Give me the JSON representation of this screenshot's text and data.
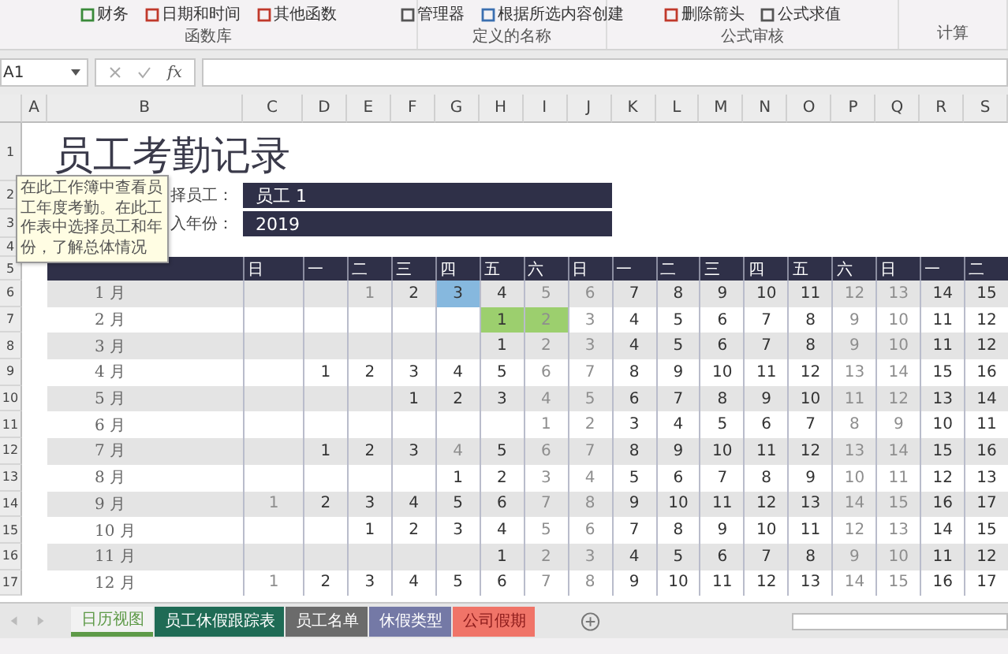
{
  "ribbon": {
    "groups": [
      {
        "label": "函数库",
        "items": [
          "财务",
          "日期和时间",
          "其他函数"
        ]
      },
      {
        "label": "定义的名称",
        "items": [
          "管理器",
          "根据所选内容创建"
        ]
      },
      {
        "label": "公式审核",
        "items": [
          "删除箭头",
          "公式求值"
        ]
      },
      {
        "label": "计算"
      }
    ]
  },
  "formula_bar": {
    "name_box": "A1",
    "function_label": "fx"
  },
  "columns": [
    "A",
    "B",
    "C",
    "D",
    "E",
    "F",
    "G",
    "H",
    "I",
    "J",
    "K",
    "L",
    "M",
    "N",
    "O",
    "P",
    "Q",
    "R",
    "S"
  ],
  "row_numbers": [
    "1",
    "2",
    "3",
    "4",
    "5",
    "6",
    "7",
    "8",
    "9",
    "10",
    "11",
    "12",
    "13",
    "14",
    "15",
    "16",
    "17"
  ],
  "sheet": {
    "title": "员工考勤记录",
    "fields": [
      {
        "label": "择员工：",
        "value": "员工 1"
      },
      {
        "label": "入年份：",
        "value": "2019"
      }
    ],
    "tooltip": "在此工作簿中查看员工年度考勤。在此工作表中选择员工和年份，了解总体情况",
    "weekdays": [
      "日",
      "一",
      "二",
      "三",
      "四",
      "五",
      "六",
      "日",
      "一",
      "二",
      "三",
      "四",
      "五",
      "六",
      "日",
      "一",
      "二"
    ],
    "months": [
      {
        "label": "1 月",
        "days": [
          {
            "kind": "blank"
          },
          {
            "kind": "blank"
          },
          {
            "kind": "date",
            "day": "1",
            "muted": true
          },
          {
            "kind": "date",
            "day": "2",
            "muted": false
          },
          {
            "kind": "date",
            "day": "3",
            "muted": false,
            "color": "#86b8de"
          },
          {
            "kind": "date",
            "day": "4",
            "muted": false
          },
          {
            "kind": "date",
            "day": "5",
            "muted": true
          },
          {
            "kind": "date",
            "day": "6",
            "muted": true
          },
          {
            "kind": "date",
            "day": "7",
            "muted": false
          },
          {
            "kind": "date",
            "day": "8",
            "muted": false
          },
          {
            "kind": "date",
            "day": "9",
            "muted": false
          },
          {
            "kind": "date",
            "day": "10",
            "muted": false
          },
          {
            "kind": "date",
            "day": "11",
            "muted": false
          },
          {
            "kind": "date",
            "day": "12",
            "muted": true
          },
          {
            "kind": "date",
            "day": "13",
            "muted": true
          },
          {
            "kind": "date",
            "day": "14",
            "muted": false
          },
          {
            "kind": "date",
            "day": "15",
            "muted": false
          }
        ]
      },
      {
        "label": "2 月",
        "days": [
          {
            "kind": "blank"
          },
          {
            "kind": "blank"
          },
          {
            "kind": "blank"
          },
          {
            "kind": "blank"
          },
          {
            "kind": "blank"
          },
          {
            "kind": "date",
            "day": "1",
            "muted": false,
            "color": "#9ccf6e"
          },
          {
            "kind": "date",
            "day": "2",
            "muted": true,
            "color": "#9ccf6e"
          },
          {
            "kind": "date",
            "day": "3",
            "muted": true
          },
          {
            "kind": "date",
            "day": "4",
            "muted": false
          },
          {
            "kind": "date",
            "day": "5",
            "muted": false
          },
          {
            "kind": "date",
            "day": "6",
            "muted": false
          },
          {
            "kind": "date",
            "day": "7",
            "muted": false
          },
          {
            "kind": "date",
            "day": "8",
            "muted": false
          },
          {
            "kind": "date",
            "day": "9",
            "muted": true
          },
          {
            "kind": "date",
            "day": "10",
            "muted": true
          },
          {
            "kind": "date",
            "day": "11",
            "muted": false
          },
          {
            "kind": "date",
            "day": "12",
            "muted": false
          }
        ]
      },
      {
        "label": "3 月",
        "days": [
          {
            "kind": "blank"
          },
          {
            "kind": "blank"
          },
          {
            "kind": "blank"
          },
          {
            "kind": "blank"
          },
          {
            "kind": "blank"
          },
          {
            "kind": "date",
            "day": "1",
            "muted": false
          },
          {
            "kind": "date",
            "day": "2",
            "muted": true
          },
          {
            "kind": "date",
            "day": "3",
            "muted": true
          },
          {
            "kind": "date",
            "day": "4",
            "muted": false
          },
          {
            "kind": "date",
            "day": "5",
            "muted": false
          },
          {
            "kind": "date",
            "day": "6",
            "muted": false
          },
          {
            "kind": "date",
            "day": "7",
            "muted": false
          },
          {
            "kind": "date",
            "day": "8",
            "muted": false
          },
          {
            "kind": "date",
            "day": "9",
            "muted": true
          },
          {
            "kind": "date",
            "day": "10",
            "muted": true
          },
          {
            "kind": "date",
            "day": "11",
            "muted": false
          },
          {
            "kind": "date",
            "day": "12",
            "muted": false
          }
        ]
      },
      {
        "label": "4 月",
        "days": [
          {
            "kind": "blank"
          },
          {
            "kind": "date",
            "day": "1",
            "muted": false
          },
          {
            "kind": "date",
            "day": "2",
            "muted": false
          },
          {
            "kind": "date",
            "day": "3",
            "muted": false
          },
          {
            "kind": "date",
            "day": "4",
            "muted": false
          },
          {
            "kind": "date",
            "day": "5",
            "muted": false
          },
          {
            "kind": "date",
            "day": "6",
            "muted": true
          },
          {
            "kind": "date",
            "day": "7",
            "muted": true
          },
          {
            "kind": "date",
            "day": "8",
            "muted": false
          },
          {
            "kind": "date",
            "day": "9",
            "muted": false
          },
          {
            "kind": "date",
            "day": "10",
            "muted": false
          },
          {
            "kind": "date",
            "day": "11",
            "muted": false
          },
          {
            "kind": "date",
            "day": "12",
            "muted": false
          },
          {
            "kind": "date",
            "day": "13",
            "muted": true
          },
          {
            "kind": "date",
            "day": "14",
            "muted": true
          },
          {
            "kind": "date",
            "day": "15",
            "muted": false
          },
          {
            "kind": "date",
            "day": "16",
            "muted": false
          }
        ]
      },
      {
        "label": "5 月",
        "days": [
          {
            "kind": "blank"
          },
          {
            "kind": "blank"
          },
          {
            "kind": "blank"
          },
          {
            "kind": "date",
            "day": "1",
            "muted": false
          },
          {
            "kind": "date",
            "day": "2",
            "muted": false
          },
          {
            "kind": "date",
            "day": "3",
            "muted": false
          },
          {
            "kind": "date",
            "day": "4",
            "muted": true
          },
          {
            "kind": "date",
            "day": "5",
            "muted": true
          },
          {
            "kind": "date",
            "day": "6",
            "muted": false
          },
          {
            "kind": "date",
            "day": "7",
            "muted": false
          },
          {
            "kind": "date",
            "day": "8",
            "muted": false
          },
          {
            "kind": "date",
            "day": "9",
            "muted": false
          },
          {
            "kind": "date",
            "day": "10",
            "muted": false
          },
          {
            "kind": "date",
            "day": "11",
            "muted": true
          },
          {
            "kind": "date",
            "day": "12",
            "muted": true
          },
          {
            "kind": "date",
            "day": "13",
            "muted": false
          },
          {
            "kind": "date",
            "day": "14",
            "muted": false
          }
        ]
      },
      {
        "label": "6 月",
        "days": [
          {
            "kind": "blank"
          },
          {
            "kind": "blank"
          },
          {
            "kind": "blank"
          },
          {
            "kind": "blank"
          },
          {
            "kind": "blank"
          },
          {
            "kind": "blank"
          },
          {
            "kind": "date",
            "day": "1",
            "muted": true
          },
          {
            "kind": "date",
            "day": "2",
            "muted": true
          },
          {
            "kind": "date",
            "day": "3",
            "muted": false
          },
          {
            "kind": "date",
            "day": "4",
            "muted": false
          },
          {
            "kind": "date",
            "day": "5",
            "muted": false
          },
          {
            "kind": "date",
            "day": "6",
            "muted": false
          },
          {
            "kind": "date",
            "day": "7",
            "muted": false
          },
          {
            "kind": "date",
            "day": "8",
            "muted": true
          },
          {
            "kind": "date",
            "day": "9",
            "muted": true
          },
          {
            "kind": "date",
            "day": "10",
            "muted": false
          },
          {
            "kind": "date",
            "day": "11",
            "muted": false
          }
        ]
      },
      {
        "label": "7 月",
        "days": [
          {
            "kind": "blank"
          },
          {
            "kind": "date",
            "day": "1",
            "muted": false
          },
          {
            "kind": "date",
            "day": "2",
            "muted": false
          },
          {
            "kind": "date",
            "day": "3",
            "muted": false
          },
          {
            "kind": "date",
            "day": "4",
            "muted": true
          },
          {
            "kind": "date",
            "day": "5",
            "muted": false
          },
          {
            "kind": "date",
            "day": "6",
            "muted": true
          },
          {
            "kind": "date",
            "day": "7",
            "muted": true
          },
          {
            "kind": "date",
            "day": "8",
            "muted": false
          },
          {
            "kind": "date",
            "day": "9",
            "muted": false
          },
          {
            "kind": "date",
            "day": "10",
            "muted": false
          },
          {
            "kind": "date",
            "day": "11",
            "muted": false
          },
          {
            "kind": "date",
            "day": "12",
            "muted": false
          },
          {
            "kind": "date",
            "day": "13",
            "muted": true
          },
          {
            "kind": "date",
            "day": "14",
            "muted": true
          },
          {
            "kind": "date",
            "day": "15",
            "muted": false
          },
          {
            "kind": "date",
            "day": "16",
            "muted": false
          }
        ]
      },
      {
        "label": "8 月",
        "days": [
          {
            "kind": "blank"
          },
          {
            "kind": "blank"
          },
          {
            "kind": "blank"
          },
          {
            "kind": "blank"
          },
          {
            "kind": "date",
            "day": "1",
            "muted": false
          },
          {
            "kind": "date",
            "day": "2",
            "muted": false
          },
          {
            "kind": "date",
            "day": "3",
            "muted": true
          },
          {
            "kind": "date",
            "day": "4",
            "muted": true
          },
          {
            "kind": "date",
            "day": "5",
            "muted": false
          },
          {
            "kind": "date",
            "day": "6",
            "muted": false
          },
          {
            "kind": "date",
            "day": "7",
            "muted": false
          },
          {
            "kind": "date",
            "day": "8",
            "muted": false
          },
          {
            "kind": "date",
            "day": "9",
            "muted": false
          },
          {
            "kind": "date",
            "day": "10",
            "muted": true
          },
          {
            "kind": "date",
            "day": "11",
            "muted": true
          },
          {
            "kind": "date",
            "day": "12",
            "muted": false
          },
          {
            "kind": "date",
            "day": "13",
            "muted": false
          }
        ]
      },
      {
        "label": "9 月",
        "days": [
          {
            "kind": "date",
            "day": "1",
            "muted": true
          },
          {
            "kind": "date",
            "day": "2",
            "muted": false
          },
          {
            "kind": "date",
            "day": "3",
            "muted": false
          },
          {
            "kind": "date",
            "day": "4",
            "muted": false
          },
          {
            "kind": "date",
            "day": "5",
            "muted": false
          },
          {
            "kind": "date",
            "day": "6",
            "muted": false
          },
          {
            "kind": "date",
            "day": "7",
            "muted": true
          },
          {
            "kind": "date",
            "day": "8",
            "muted": true
          },
          {
            "kind": "date",
            "day": "9",
            "muted": false
          },
          {
            "kind": "date",
            "day": "10",
            "muted": false
          },
          {
            "kind": "date",
            "day": "11",
            "muted": false
          },
          {
            "kind": "date",
            "day": "12",
            "muted": false
          },
          {
            "kind": "date",
            "day": "13",
            "muted": false
          },
          {
            "kind": "date",
            "day": "14",
            "muted": true
          },
          {
            "kind": "date",
            "day": "15",
            "muted": true
          },
          {
            "kind": "date",
            "day": "16",
            "muted": false
          },
          {
            "kind": "date",
            "day": "17",
            "muted": false
          }
        ]
      },
      {
        "label": "10 月",
        "days": [
          {
            "kind": "blank"
          },
          {
            "kind": "blank"
          },
          {
            "kind": "date",
            "day": "1",
            "muted": false
          },
          {
            "kind": "date",
            "day": "2",
            "muted": false
          },
          {
            "kind": "date",
            "day": "3",
            "muted": false
          },
          {
            "kind": "date",
            "day": "4",
            "muted": false
          },
          {
            "kind": "date",
            "day": "5",
            "muted": true
          },
          {
            "kind": "date",
            "day": "6",
            "muted": true
          },
          {
            "kind": "date",
            "day": "7",
            "muted": false
          },
          {
            "kind": "date",
            "day": "8",
            "muted": false
          },
          {
            "kind": "date",
            "day": "9",
            "muted": false
          },
          {
            "kind": "date",
            "day": "10",
            "muted": false
          },
          {
            "kind": "date",
            "day": "11",
            "muted": false
          },
          {
            "kind": "date",
            "day": "12",
            "muted": true
          },
          {
            "kind": "date",
            "day": "13",
            "muted": true
          },
          {
            "kind": "date",
            "day": "14",
            "muted": false
          },
          {
            "kind": "date",
            "day": "15",
            "muted": false
          }
        ]
      },
      {
        "label": "11 月",
        "days": [
          {
            "kind": "blank"
          },
          {
            "kind": "blank"
          },
          {
            "kind": "blank"
          },
          {
            "kind": "blank"
          },
          {
            "kind": "blank"
          },
          {
            "kind": "date",
            "day": "1",
            "muted": false
          },
          {
            "kind": "date",
            "day": "2",
            "muted": true
          },
          {
            "kind": "date",
            "day": "3",
            "muted": true
          },
          {
            "kind": "date",
            "day": "4",
            "muted": false
          },
          {
            "kind": "date",
            "day": "5",
            "muted": false
          },
          {
            "kind": "date",
            "day": "6",
            "muted": false
          },
          {
            "kind": "date",
            "day": "7",
            "muted": false
          },
          {
            "kind": "date",
            "day": "8",
            "muted": false
          },
          {
            "kind": "date",
            "day": "9",
            "muted": true
          },
          {
            "kind": "date",
            "day": "10",
            "muted": true
          },
          {
            "kind": "date",
            "day": "11",
            "muted": false
          },
          {
            "kind": "date",
            "day": "12",
            "muted": false
          }
        ]
      },
      {
        "label": "12 月",
        "days": [
          {
            "kind": "date",
            "day": "1",
            "muted": true
          },
          {
            "kind": "date",
            "day": "2",
            "muted": false
          },
          {
            "kind": "date",
            "day": "3",
            "muted": false
          },
          {
            "kind": "date",
            "day": "4",
            "muted": false
          },
          {
            "kind": "date",
            "day": "5",
            "muted": false
          },
          {
            "kind": "date",
            "day": "6",
            "muted": false
          },
          {
            "kind": "date",
            "day": "7",
            "muted": true
          },
          {
            "kind": "date",
            "day": "8",
            "muted": true
          },
          {
            "kind": "date",
            "day": "9",
            "muted": false
          },
          {
            "kind": "date",
            "day": "10",
            "muted": false
          },
          {
            "kind": "date",
            "day": "11",
            "muted": false
          },
          {
            "kind": "date",
            "day": "12",
            "muted": false
          },
          {
            "kind": "date",
            "day": "13",
            "muted": false
          },
          {
            "kind": "date",
            "day": "14",
            "muted": true
          },
          {
            "kind": "date",
            "day": "15",
            "muted": true
          },
          {
            "kind": "date",
            "day": "16",
            "muted": false
          },
          {
            "kind": "date",
            "day": "17",
            "muted": false
          }
        ]
      }
    ]
  },
  "sheet_tabs": [
    {
      "label": "日历视图",
      "selected": true,
      "color": "#5e9a48"
    },
    {
      "label": "员工休假跟踪表",
      "selected": false,
      "color": "#1f6b55"
    },
    {
      "label": "员工名单",
      "selected": false,
      "color": "#6b6b6b"
    },
    {
      "label": "休假类型",
      "selected": false,
      "color": "#7479a6"
    },
    {
      "label": "公司假期",
      "selected": false,
      "color": "#f07468"
    }
  ]
}
